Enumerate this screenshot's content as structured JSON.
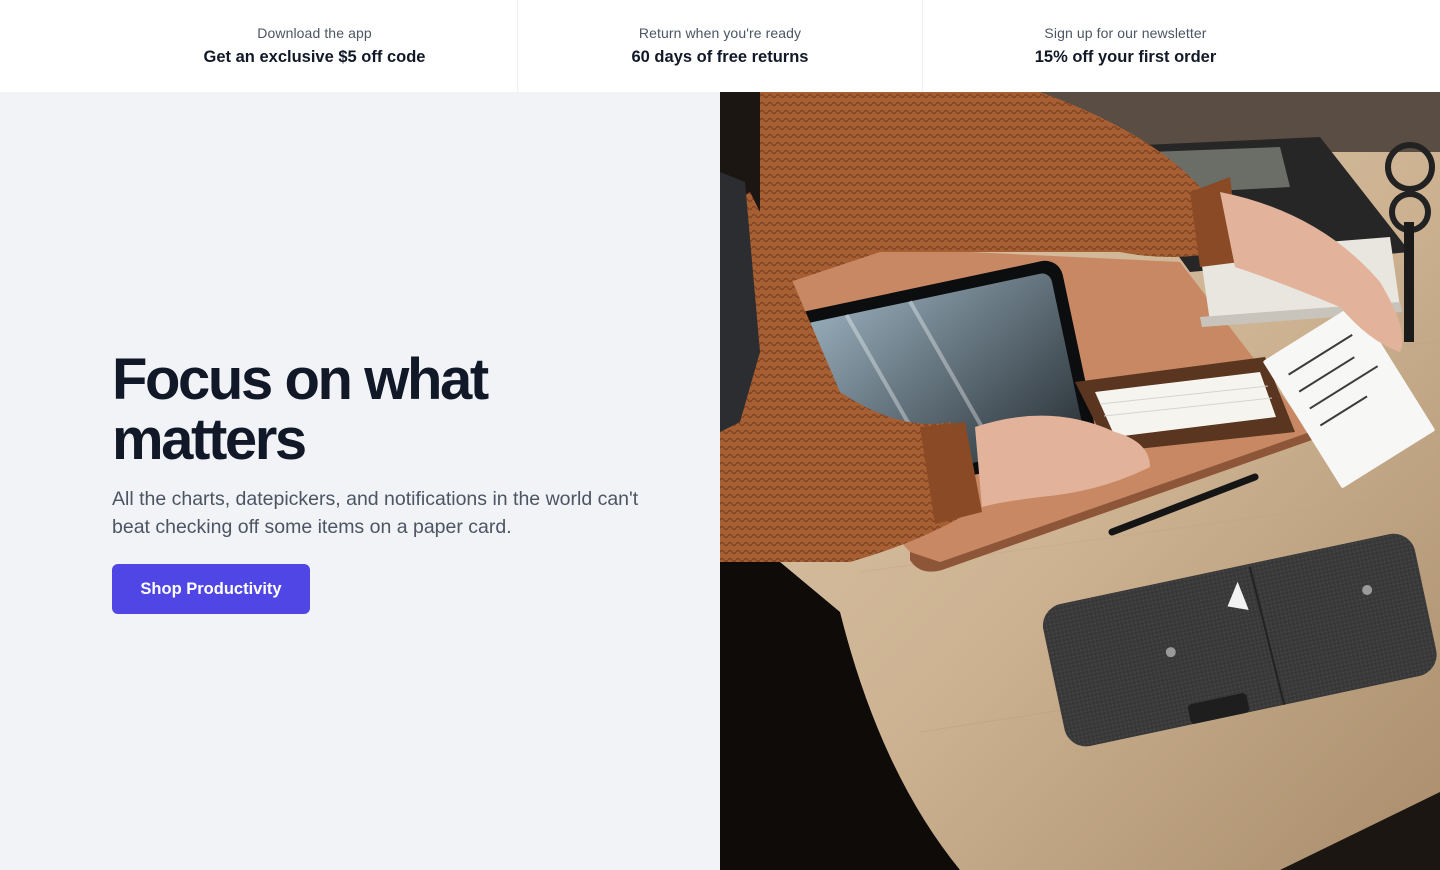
{
  "perks": [
    {
      "label": "Download the app",
      "value": "Get an exclusive $5 off code"
    },
    {
      "label": "Return when you're ready",
      "value": "60 days of free returns"
    },
    {
      "label": "Sign up for our newsletter",
      "value": "15% off your first order"
    }
  ],
  "hero": {
    "title": "Focus on what matters",
    "subtitle": "All the charts, datepickers, and notifications in the world can't beat checking off some items on a paper card.",
    "cta_label": "Shop Productivity",
    "image_subject": "desk-with-paper-card-tray-photo"
  },
  "colors": {
    "accent": "#4f46e5",
    "hero_bg": "#f1f3f6",
    "heading": "#111827",
    "body_text": "#4b5563"
  }
}
